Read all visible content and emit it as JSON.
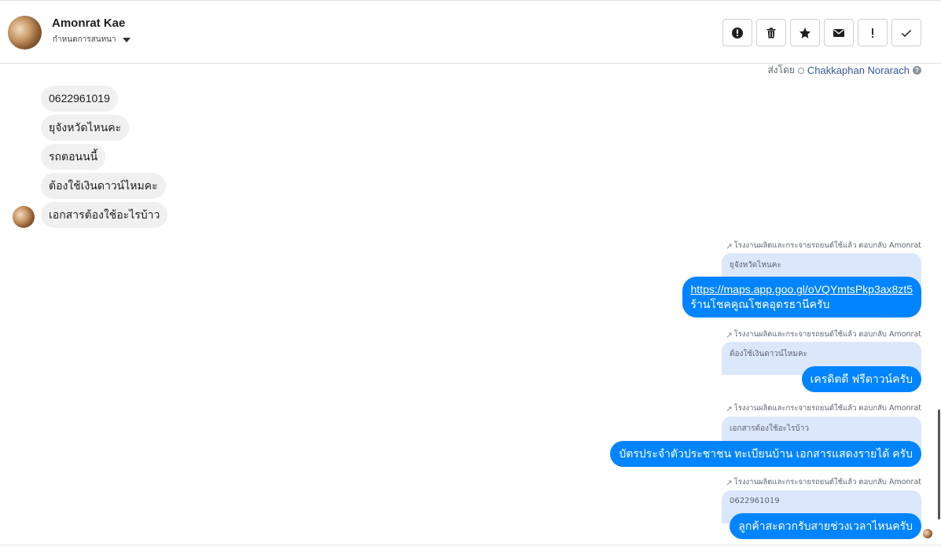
{
  "header": {
    "contact_name": "Amonrat Kae",
    "conversation_label": "กำหนดการสนทนา"
  },
  "toolbar": {
    "buttons": [
      {
        "icon": "alert-circle-icon"
      },
      {
        "icon": "trash-icon"
      },
      {
        "icon": "star-icon"
      },
      {
        "icon": "envelope-icon"
      },
      {
        "icon": "exclamation-icon"
      },
      {
        "icon": "check-icon"
      }
    ]
  },
  "sender": {
    "prefix": "ส่งโดย",
    "name": "Chakkaphan Norarach",
    "help": "?"
  },
  "incoming": [
    "0622961019",
    "ยุจังหวัดไหนคะ",
    "รถตอนนนี้",
    "ต้องใช้เงินดาวน์ไหมคะ",
    "เอกสารต้องใช้อะไรบ้าว"
  ],
  "replies": [
    {
      "meta": "โรงงานผลิตและกระจายรถยนต์ใช้แล้ว ตอบกลับ Amonrat",
      "quote": "ยุจังหวัดไหนคะ",
      "url": "https://maps.app.goo.gl/oVQYmtsPkp3ax8zt5",
      "text": "ร้านโชคคูณโชคอุดรธานีครับ"
    },
    {
      "meta": "โรงงานผลิตและกระจายรถยนต์ใช้แล้ว ตอบกลับ Amonrat",
      "quote": "ต้องใช้เงินดาวน์ไหมคะ",
      "text": "เครดิตดี ฟรีดาวน์ครับ"
    },
    {
      "meta": "โรงงานผลิตและกระจายรถยนต์ใช้แล้ว ตอบกลับ Amonrat",
      "quote": "เอกสารต้องใช้อะไรบ้าว",
      "text": "บัตรประจำตัวประชาชน ทะเบียนบ้าน เอกสารแสดงรายได้ ครับ"
    },
    {
      "meta": "โรงงานผลิตและกระจายรถยนต์ใช้แล้ว ตอบกลับ Amonrat",
      "quote": "0622961019",
      "text": "ลูกค้าสะดวกรับสายช่วงเวลาไหนครับ"
    }
  ]
}
